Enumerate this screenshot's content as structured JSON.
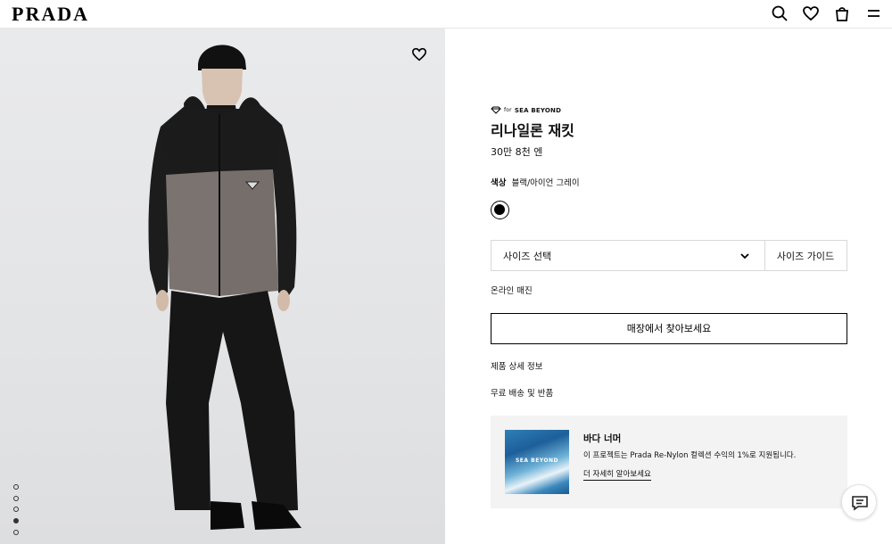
{
  "header": {
    "logo": "PRADA",
    "icons": [
      "search-icon",
      "heart-icon",
      "bag-icon",
      "menu-icon"
    ]
  },
  "gallery": {
    "slide_count": 5,
    "active_slide": 4,
    "wishlist_icon": "heart-icon"
  },
  "product": {
    "sea_badge_for": "for",
    "sea_badge": "SEA BEYOND",
    "title": "리나일론 재킷",
    "price": "30만 8천 엔",
    "color_label": "색상",
    "color_value": "블랙/아이언 그레이",
    "swatch_color": "#000000",
    "size_select_label": "사이즈 선택",
    "size_guide_label": "사이즈 가이드",
    "availability": "온라인 매진",
    "store_button": "매장에서 찾아보세요",
    "details_link": "제품 상세 정보",
    "shipping_link": "무료 배송 및 반품"
  },
  "promo": {
    "image_text": "SEA BEYOND",
    "title": "바다 너머",
    "description": "이 프로젝트는 Prada Re-Nylon 컬렉션 수익의 1%로 지원됩니다.",
    "link": "더 자세히 알아보세요"
  },
  "chat": {
    "icon": "chat-icon"
  }
}
